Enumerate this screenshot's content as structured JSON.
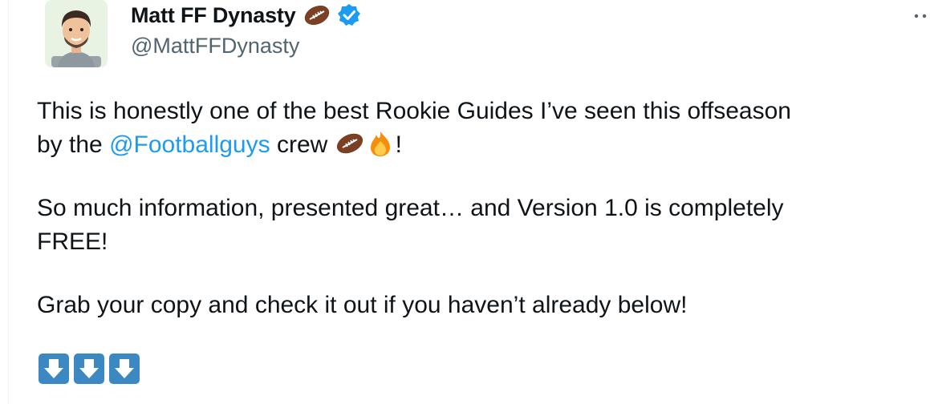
{
  "tweet": {
    "author": {
      "display_name": "Matt FF Dynasty",
      "handle": "@MattFFDynasty",
      "name_emoji": "football-icon",
      "verified": "verified-badge-icon"
    },
    "text": {
      "line1": "This is honestly one of the best Rookie Guides I’ve seen this offseason",
      "line2_before": "by the ",
      "line2_mention": "@Footballguys",
      "line2_after": " crew ",
      "line2_end": "!",
      "line3": "So much information, presented great… and Version 1.0 is completely",
      "line4": "FREE!",
      "line5": "Grab your copy and check it out if you haven’t already below!"
    },
    "emojis": [
      "football-icon",
      "fire-icon",
      "down-arrow-icon",
      "down-arrow-icon",
      "down-arrow-icon"
    ],
    "colors": {
      "link": "#1d9bf0",
      "text": "#0f1419",
      "secondary": "#536471",
      "verified": "#1d9bf0",
      "arrow_box": "#3b88c3"
    }
  }
}
